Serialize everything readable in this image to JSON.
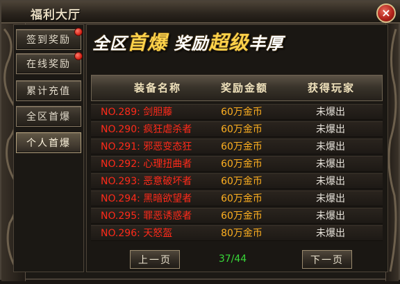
{
  "window": {
    "title": "福利大厅",
    "close_label": "×"
  },
  "sidebar": {
    "items": [
      {
        "label": "签到奖励",
        "has_notification": true
      },
      {
        "label": "在线奖励",
        "has_notification": true
      },
      {
        "label": "累计充值",
        "has_notification": false
      },
      {
        "label": "全区首爆",
        "has_notification": false
      },
      {
        "label": "个人首爆",
        "has_notification": false,
        "active": true
      }
    ]
  },
  "banner": {
    "part1": "全区",
    "part2": "首爆",
    "part3": " 奖励",
    "part4": "超级",
    "part5": "丰厚"
  },
  "table": {
    "headers": [
      "装备名称",
      "奖励金额",
      "获得玩家"
    ],
    "rows": [
      {
        "name": "NO.289:  剑胆藤",
        "reward": "60万金币",
        "player": "未爆出"
      },
      {
        "name": "NO.290:  疯狂虐杀者",
        "reward": "60万金币",
        "player": "未爆出"
      },
      {
        "name": "NO.291:  邪恶变态狂",
        "reward": "60万金币",
        "player": "未爆出"
      },
      {
        "name": "NO.292:  心理扭曲者",
        "reward": "60万金币",
        "player": "未爆出"
      },
      {
        "name": "NO.293:  恶意破坏者",
        "reward": "60万金币",
        "player": "未爆出"
      },
      {
        "name": "NO.294:  黑暗欲望者",
        "reward": "60万金币",
        "player": "未爆出"
      },
      {
        "name": "NO.295:  罪恶诱惑者",
        "reward": "60万金币",
        "player": "未爆出"
      },
      {
        "name": "NO.296:  天怒盔",
        "reward": "80万金币",
        "player": "未爆出"
      }
    ]
  },
  "pagination": {
    "prev_label": "上一页",
    "next_label": "下一页",
    "indicator": "37/44"
  },
  "colors": {
    "item_name": "#ff2a1a",
    "reward": "#ffb020",
    "player": "#e8e4dc",
    "page_indicator": "#38d838",
    "banner_highlight": "#ffd24a"
  }
}
